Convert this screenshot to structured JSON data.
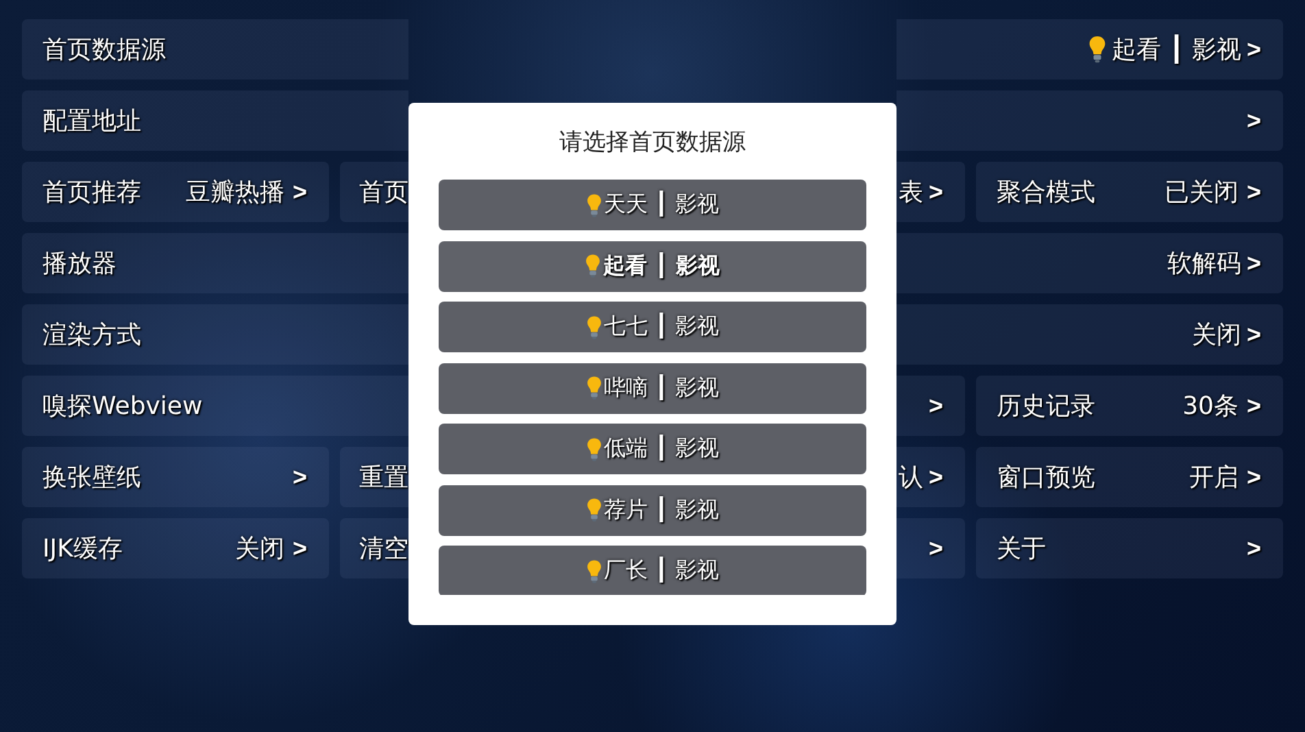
{
  "settings": {
    "rows": [
      {
        "kind": "single",
        "tiles": [
          {
            "kind": "source",
            "label": "首页数据源",
            "value": "起看 ┃ 影视",
            "arrow": ">"
          }
        ]
      },
      {
        "kind": "single",
        "tiles": [
          {
            "kind": "plain",
            "label": "配置地址",
            "arrow": ">"
          }
        ]
      },
      {
        "kind": "triple",
        "tiles": [
          {
            "kind": "plain",
            "label": "首页推荐",
            "value": "豆瓣热播",
            "arrow": ">"
          },
          {
            "kind": "plain",
            "label": "首页",
            "value": "表",
            "arrow": ">"
          },
          {
            "kind": "plain",
            "label": "聚合模式",
            "value": "已关闭",
            "arrow": ">"
          }
        ]
      },
      {
        "kind": "single",
        "tiles": [
          {
            "kind": "plain",
            "label": "播放器",
            "value": "软解码",
            "arrow": ">"
          }
        ]
      },
      {
        "kind": "single",
        "tiles": [
          {
            "kind": "plain",
            "label": "渲染方式",
            "value": "关闭",
            "arrow": ">"
          }
        ]
      },
      {
        "kind": "pair",
        "tiles": [
          {
            "kind": "plain",
            "label": "嗅探Webview",
            "arrow": ">"
          },
          {
            "kind": "plain",
            "label": "历史记录",
            "value": "30条",
            "arrow": ">"
          }
        ]
      },
      {
        "kind": "triple",
        "tiles": [
          {
            "kind": "plain",
            "label": "换张壁纸",
            "arrow": ">"
          },
          {
            "kind": "plain",
            "label": "重置",
            "value": "认",
            "arrow": ">"
          },
          {
            "kind": "plain",
            "label": "窗口预览",
            "value": "开启",
            "arrow": ">"
          }
        ]
      },
      {
        "kind": "triple",
        "tiles": [
          {
            "kind": "plain",
            "label": "IJK缓存",
            "value": "关闭",
            "arrow": ">"
          },
          {
            "kind": "plain",
            "label": "清空",
            "arrow": ">"
          },
          {
            "kind": "plain",
            "label": "关于",
            "arrow": ">"
          }
        ]
      }
    ]
  },
  "dialog": {
    "title": "请选择首页数据源",
    "options": [
      {
        "label": "天天 ┃ 影视",
        "selected": false
      },
      {
        "label": "起看 ┃ 影视",
        "selected": true
      },
      {
        "label": "七七 ┃ 影视",
        "selected": false
      },
      {
        "label": "哔嘀 ┃ 影视",
        "selected": false
      },
      {
        "label": "低端 ┃ 影视",
        "selected": false
      },
      {
        "label": "荐片 ┃ 影视",
        "selected": false
      },
      {
        "label": "厂长 ┃ 影视",
        "selected": false
      }
    ]
  }
}
